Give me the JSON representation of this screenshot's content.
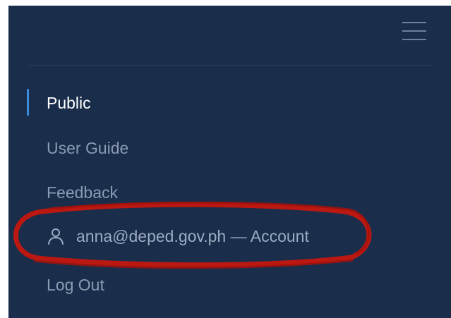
{
  "header": {
    "menu_icon": "hamburger-menu-icon"
  },
  "nav": {
    "items": [
      {
        "label": "Public",
        "active": true
      },
      {
        "label": "User Guide",
        "active": false
      },
      {
        "label": "Feedback",
        "active": false
      },
      {
        "label": "anna@deped.gov.ph — Account",
        "icon": "user-icon",
        "highlighted": true
      },
      {
        "label": "Log Out",
        "active": false
      }
    ]
  },
  "colors": {
    "panel_background": "#1a2d4a",
    "active_text": "#ffffff",
    "inactive_text": "#8a9bb2",
    "active_indicator": "#3b8be0",
    "annotation": "#c4170f"
  }
}
